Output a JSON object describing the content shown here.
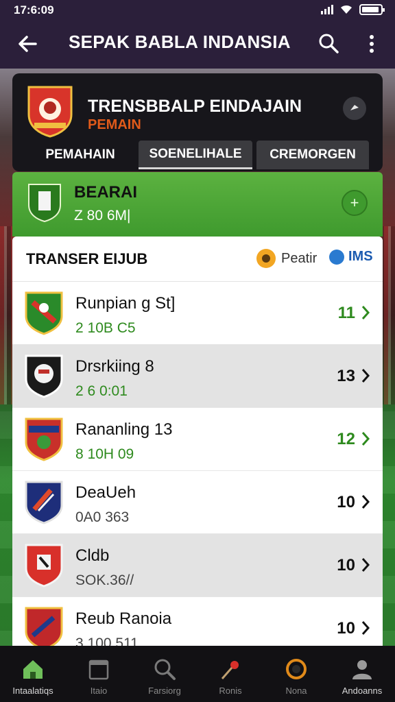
{
  "status_bar": {
    "time": "17:6:09"
  },
  "app_bar": {
    "title": "SEPAK BABLA INDANSIA",
    "back_icon": "arrow-left-icon",
    "search_icon": "search-icon",
    "more_icon": "more-vertical-icon"
  },
  "header": {
    "title": "TRENSBBALP EINDAJAIN",
    "subtitle": "PEMAIN",
    "tabs": [
      {
        "label": "PEMAHAIN"
      },
      {
        "label": "SOENELIHALE"
      },
      {
        "label": "CREMORGEN"
      }
    ]
  },
  "banner": {
    "title": "BEARAI",
    "value": "Z 80 6M|",
    "action_icon": "plus-icon"
  },
  "list": {
    "header_title": "TRANSER EIJUB",
    "filter_1": "Peatir",
    "filter_2": "IMS",
    "rows": [
      {
        "name": "Runpian g St]",
        "stat": "2 10B C5",
        "count": "11",
        "count_color": "green"
      },
      {
        "name": "Drsrkiing 8",
        "stat": "2 6 0:01",
        "count": "13",
        "count_color": "black"
      },
      {
        "name": "Rananling 13",
        "stat": "8 10H 09",
        "count": "12",
        "count_color": "green"
      },
      {
        "name": "DeaUeh",
        "stat": "0A0 363",
        "count": "10",
        "count_color": "black"
      },
      {
        "name": "Cldb",
        "stat": "SOK.36//",
        "count": "10",
        "count_color": "black"
      },
      {
        "name": "Reub Ranoia",
        "stat": "3 100 511",
        "count": "10",
        "count_color": "black"
      }
    ]
  },
  "bottom_nav": [
    {
      "label": "Intaalatiqs",
      "icon": "home-icon"
    },
    {
      "label": "Itaio",
      "icon": "calendar-icon"
    },
    {
      "label": "Farsiorg",
      "icon": "search-icon"
    },
    {
      "label": "Ronis",
      "icon": "whistle-icon"
    },
    {
      "label": "Nona",
      "icon": "ball-icon"
    },
    {
      "label": "Andoanns",
      "icon": "user-icon"
    }
  ],
  "colors": {
    "appbar": "#2b1f3a",
    "accent_green": "#4ea536",
    "accent_orange": "#e05a1a",
    "dark_card": "#17161b"
  }
}
